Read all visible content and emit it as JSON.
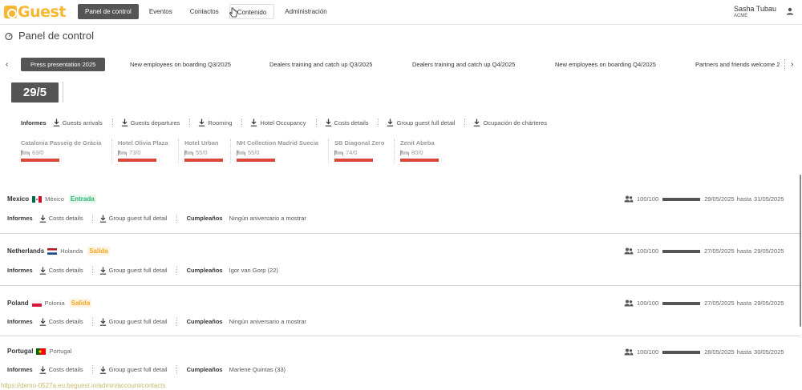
{
  "app": {
    "logo_text": "Guest"
  },
  "nav": [
    {
      "label": "Panel de control",
      "active": true
    },
    {
      "label": "Eventos",
      "active": false
    },
    {
      "label": "Contactos",
      "active": false
    },
    {
      "label": "Contenido",
      "active": false
    },
    {
      "label": "Administración",
      "active": false
    }
  ],
  "user": {
    "name": "Sasha Tubau",
    "org": "ACME"
  },
  "page": {
    "title": "Panel de control"
  },
  "event_tabs": [
    "Press presentation 2025",
    "New employees on boarding Q3/2025",
    "Dealers training and catch up Q3/2025",
    "Dealers training and catch up Q4/2025",
    "New employees on boarding Q4/2025",
    "Partners and friends welcome 2"
  ],
  "date_box": "29/5",
  "reports": {
    "label": "Informes",
    "items": [
      "Guests arrivals",
      "Guests departures",
      "Rooming",
      "Hotel Occupancy",
      "Costs details",
      "Group guest full detail",
      "Ocupación de chárteres"
    ]
  },
  "hotels": [
    {
      "name": "Catalonia Passeig de Gràcia",
      "count": "63/0"
    },
    {
      "name": "Hotel Olivia Plaza",
      "count": "73/0"
    },
    {
      "name": "Hotel Urban",
      "count": "55/0"
    },
    {
      "name": "NH Collection Madrid Suecia",
      "count": "55/0"
    },
    {
      "name": "SB Diagonal Zero",
      "count": "74/0"
    },
    {
      "name": "Zenit Abeba",
      "count": "80/0"
    }
  ],
  "countries": [
    {
      "name": "Mexico",
      "local": "México",
      "badge": "Entrada",
      "badge_type": "in",
      "reports_label": "Informes",
      "reports": [
        "Costs details",
        "Group guest full detail"
      ],
      "birthdays_label": "Cumpleaños",
      "birthdays": "Ningún aniversario a mostrar",
      "count": "100/100",
      "date_from": "29/05/2025",
      "hasta": "hasta",
      "date_to": "31/05/2025"
    },
    {
      "name": "Netherlands",
      "local": "Holanda",
      "badge": "Salida",
      "badge_type": "out",
      "reports_label": "Informes",
      "reports": [
        "Costs details",
        "Group guest full detail"
      ],
      "birthdays_label": "Cumpleaños",
      "birthdays": "Igor van Gorp (22)",
      "count": "100/100",
      "date_from": "27/05/2025",
      "hasta": "hasta",
      "date_to": "29/05/2025"
    },
    {
      "name": "Poland",
      "local": "Polonia",
      "badge": "Salida",
      "badge_type": "out",
      "reports_label": "Informes",
      "reports": [
        "Costs details",
        "Group guest full detail"
      ],
      "birthdays_label": "Cumpleaños",
      "birthdays": "Ningún aniversario a mostrar",
      "count": "100/100",
      "date_from": "27/05/2025",
      "hasta": "hasta",
      "date_to": "29/05/2025"
    },
    {
      "name": "Portugal",
      "local": "Portugal",
      "badge": "",
      "badge_type": "",
      "reports_label": "Informes",
      "reports": [
        "Costs details",
        "Group guest full detail"
      ],
      "birthdays_label": "Cumpleaños",
      "birthdays": "Marlene Quintas (33)",
      "count": "100/100",
      "date_from": "28/05/2025",
      "hasta": "hasta",
      "date_to": "30/05/2025"
    }
  ],
  "status_url": "https://demo-0527a.eu.beguest.io/admin/account/contacts",
  "colors": {
    "accent": "#f7b733",
    "dark": "#555555",
    "hotel_bar": "#d9473b",
    "entrada": "#2bb673",
    "salida": "#f5a623"
  }
}
